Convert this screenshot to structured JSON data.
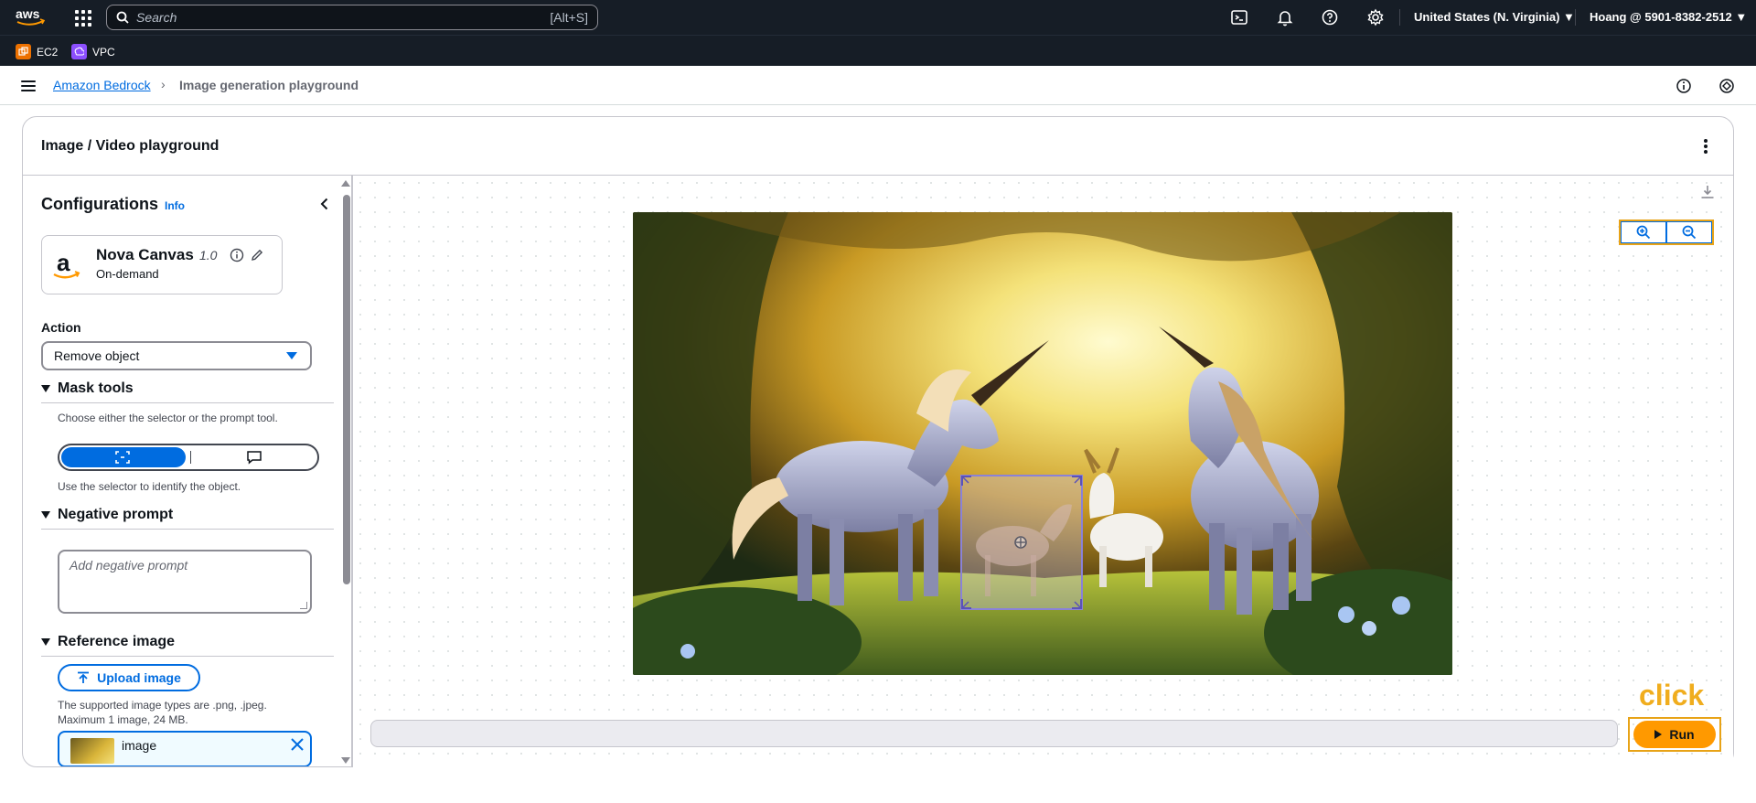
{
  "topnav": {
    "search_placeholder": "Search",
    "search_shortcut": "[Alt+S]",
    "region": "United States (N. Virginia) ▼",
    "account": "Hoang @ 5901-8382-2512 ▼"
  },
  "favorites": [
    {
      "label": "EC2",
      "color": "#ed7100",
      "icon": "ec2-icon"
    },
    {
      "label": "VPC",
      "color": "#8c4fff",
      "icon": "vpc-icon"
    }
  ],
  "breadcrumb": {
    "parent": "Amazon Bedrock",
    "current": "Image generation playground"
  },
  "container": {
    "title": "Image / Video playground"
  },
  "config": {
    "title": "Configurations",
    "info": "Info",
    "model": {
      "name": "Nova Canvas",
      "version": "1.0",
      "tier": "On-demand"
    },
    "action_label": "Action",
    "action_value": "Remove object",
    "mask_tools": {
      "heading": "Mask tools",
      "hint": "Choose either the selector or the prompt tool.",
      "selected": "selector",
      "helper": "Use the selector to identify the object."
    },
    "negative_prompt": {
      "heading": "Negative prompt",
      "placeholder": "Add negative prompt"
    },
    "reference_image": {
      "heading": "Reference image",
      "upload_label": "Upload image",
      "types_hint": "The supported image types are .png, .jpeg.",
      "limit_hint": "Maximum 1 image, 24 MB.",
      "file_name": "image"
    }
  },
  "canvas": {
    "overlay_label": "click",
    "run_label": "Run"
  },
  "colors": {
    "nav_bg": "#161d26",
    "link": "#006ce0",
    "run_button": "#ff9900",
    "highlight": "#e8a317"
  }
}
